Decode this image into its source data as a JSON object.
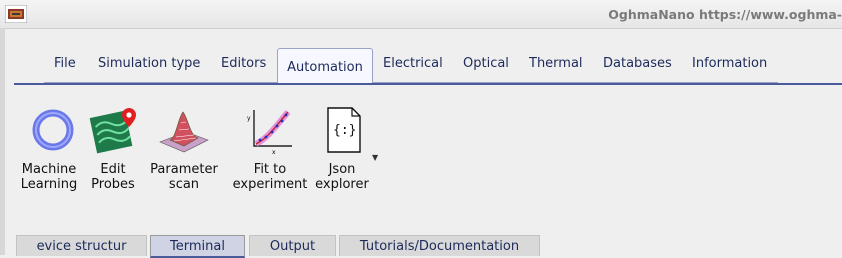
{
  "window": {
    "title": "OghmaNano https://www.oghma-"
  },
  "menu_tabs": [
    {
      "label": "File"
    },
    {
      "label": "Simulation type"
    },
    {
      "label": "Editors"
    },
    {
      "label": "Automation"
    },
    {
      "label": "Electrical"
    },
    {
      "label": "Optical"
    },
    {
      "label": "Thermal"
    },
    {
      "label": "Databases"
    },
    {
      "label": "Information"
    }
  ],
  "active_menu_tab": "Automation",
  "tools": [
    {
      "line1": "Machine",
      "line2": "Learning",
      "icon": "ring-icon"
    },
    {
      "line1": "Edit",
      "line2": "Probes",
      "icon": "map-pin-icon"
    },
    {
      "line1": "Parameter",
      "line2": "scan",
      "icon": "surface-plot-icon"
    },
    {
      "line1": "Fit to",
      "line2": "experiment",
      "icon": "fit-graph-icon"
    },
    {
      "line1": "Json",
      "line2": "explorer",
      "icon": "json-file-icon"
    }
  ],
  "bottom_tabs": [
    {
      "label": "evice structur"
    },
    {
      "label": "Terminal"
    },
    {
      "label": "Output"
    },
    {
      "label": "Tutorials/Documentation"
    }
  ],
  "active_bottom_tab": "Terminal",
  "colors": {
    "accent": "#4b5a9a",
    "tab_text": "#1d2a5a"
  }
}
